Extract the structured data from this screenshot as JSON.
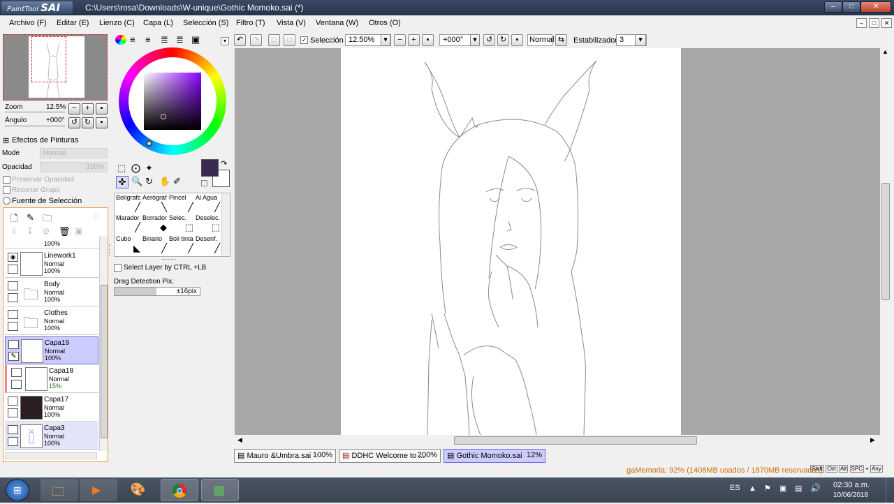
{
  "window": {
    "app_name": "PaintTool",
    "app_brand": "SAI",
    "title": "C:\\Users\\rosa\\Downloads\\W-unique\\Gothic Momoko.sai (*)"
  },
  "menu": [
    "Archivo (F)",
    "Editar (E)",
    "Lienzo (C)",
    "Capa (L)",
    "Selección (S)",
    "Filtro (T)",
    "Vista (V)",
    "Ventana (W)",
    "Otros (O)"
  ],
  "navigator": {
    "zoom_label": "Zoom",
    "zoom_value": "12.5%",
    "angle_label": "Ángulo",
    "angle_value": "+000°"
  },
  "effects": {
    "header": "Efectos de Pinturas",
    "mode_label": "Mode",
    "mode_value": "Normal",
    "opacity_label": "Opacidad",
    "opacity_value": "100%",
    "preserve_opacity": "Preservar Opacidad",
    "clip_group": "Recortar Grupo",
    "selection_source": "Fuente de Selección"
  },
  "layers": [
    {
      "name": "",
      "mode": "",
      "opacity": "100%"
    },
    {
      "name": "Linework1",
      "mode": "Normal",
      "opacity": "100%",
      "visible": true
    },
    {
      "name": "Body",
      "mode": "Normal",
      "opacity": "100%",
      "folder": true
    },
    {
      "name": "Clothes",
      "mode": "Normal",
      "opacity": "100%",
      "folder": true
    },
    {
      "name": "Capa19",
      "mode": "Normal",
      "opacity": "100%",
      "selected": true
    },
    {
      "name": "Capa18",
      "mode": "Normal",
      "opacity": "15%"
    },
    {
      "name": "Capa17",
      "mode": "Normal",
      "opacity": "100%",
      "dark": true
    },
    {
      "name": "Capa3",
      "mode": "Normal",
      "opacity": "100%",
      "sketch": true
    }
  ],
  "colors": {
    "primary": "#3a2a52",
    "secondary": "#ffffff",
    "accent_select": "#ccccff",
    "memory_text": "#d06a00"
  },
  "tools": [
    {
      "label": "Bolígrafc",
      "icon": "pen-icon"
    },
    {
      "label": "Aerógraf",
      "icon": "airbrush-icon"
    },
    {
      "label": "Pincel",
      "icon": "brush-icon"
    },
    {
      "label": "Al Agua",
      "icon": "watercolor-icon"
    },
    {
      "label": "Marador",
      "icon": "marker-icon"
    },
    {
      "label": "Borrador",
      "icon": "eraser-icon"
    },
    {
      "label": "Selec.",
      "icon": "select-brush-icon"
    },
    {
      "label": "Deselec.",
      "icon": "deselect-brush-icon"
    },
    {
      "label": "Cubo",
      "icon": "bucket-icon"
    },
    {
      "label": "Binario",
      "icon": "binary-pen-icon"
    },
    {
      "label": "Boli tinta",
      "icon": "ink-pen-icon"
    },
    {
      "label": "Desenf.",
      "icon": "blur-icon"
    }
  ],
  "tool_options": {
    "select_layer": "Select Layer by CTRL +LB",
    "drag_detection_label": "Drag Detection Pix.",
    "drag_detection_value": "±16pix"
  },
  "toolbar": {
    "selection_label": "Selección",
    "zoom": "12.50%",
    "angle": "+000°",
    "blend": "Normal",
    "stabilizer_label": "Estabilizador",
    "stabilizer_value": "3"
  },
  "doc_tabs": [
    {
      "name": "Mauro &Umbra.sai",
      "zoom": "100%"
    },
    {
      "name": "DDHC Welcome to ...",
      "zoom": "200%"
    },
    {
      "name": "Gothic Momoko.sai",
      "zoom": "12%",
      "active": true
    }
  ],
  "status": {
    "memory": "gaMemoria: 92% (1408MB usados / 1870MB reservados)",
    "keys": [
      "Shift",
      "Ctrl",
      "Alt",
      "SPC",
      "Any"
    ]
  },
  "taskbar": {
    "lang": "ES",
    "time": "02:30 a.m.",
    "date": "10/06/2018"
  }
}
